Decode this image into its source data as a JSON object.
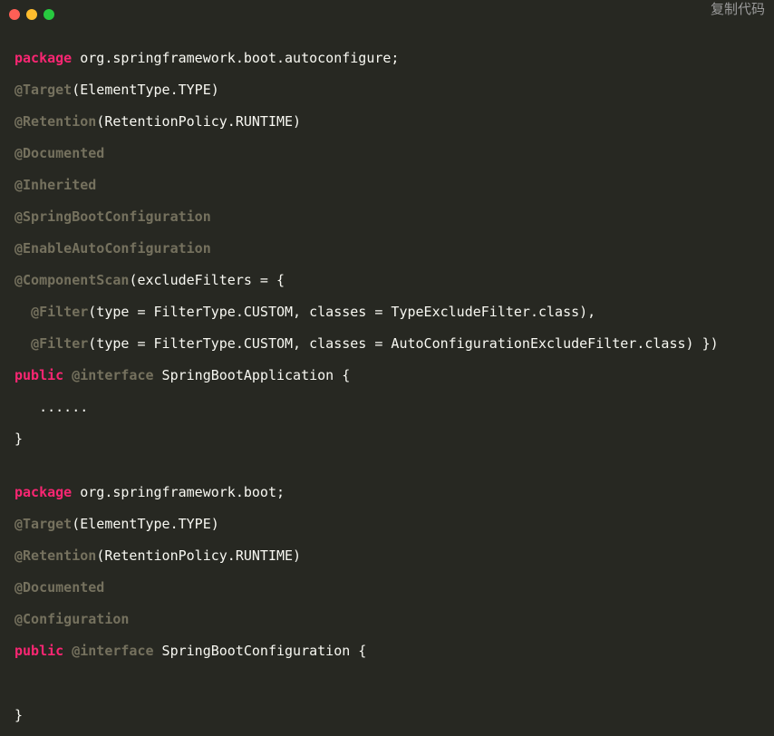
{
  "window": {
    "controls": {
      "close_color": "#ff5f56",
      "minimize_color": "#ffbd2e",
      "maximize_color": "#27c93f"
    },
    "copy_label": "复制代码"
  },
  "code": {
    "lines": [
      [
        {
          "t": "kw",
          "v": "package"
        },
        {
          "t": "pl",
          "v": " org.springframework.boot.autoconfigure;"
        }
      ],
      [
        {
          "t": "an",
          "v": "@Target"
        },
        {
          "t": "pl",
          "v": "(ElementType.TYPE)"
        }
      ],
      [
        {
          "t": "an",
          "v": "@Retention"
        },
        {
          "t": "pl",
          "v": "(RetentionPolicy.RUNTIME)"
        }
      ],
      [
        {
          "t": "an",
          "v": "@Documented"
        }
      ],
      [
        {
          "t": "an",
          "v": "@Inherited"
        }
      ],
      [
        {
          "t": "an",
          "v": "@SpringBootConfiguration"
        }
      ],
      [
        {
          "t": "an",
          "v": "@EnableAutoConfiguration"
        }
      ],
      [
        {
          "t": "an",
          "v": "@ComponentScan"
        },
        {
          "t": "pl",
          "v": "(excludeFilters = {"
        }
      ],
      [
        {
          "t": "pl",
          "v": "  "
        },
        {
          "t": "an",
          "v": "@Filter"
        },
        {
          "t": "pl",
          "v": "(type = FilterType.CUSTOM, classes = TypeExcludeFilter.class),"
        }
      ],
      [
        {
          "t": "pl",
          "v": "  "
        },
        {
          "t": "an",
          "v": "@Filter"
        },
        {
          "t": "pl",
          "v": "(type = FilterType.CUSTOM, classes = AutoConfigurationExcludeFilter.class) })"
        }
      ],
      [
        {
          "t": "kw",
          "v": "public"
        },
        {
          "t": "pl",
          "v": " "
        },
        {
          "t": "an",
          "v": "@interface"
        },
        {
          "t": "pl",
          "v": " SpringBootApplication {"
        }
      ],
      [
        {
          "t": "pl",
          "v": "   ......"
        }
      ],
      [
        {
          "t": "pl",
          "v": "}"
        }
      ],
      [],
      [
        {
          "t": "kw",
          "v": "package"
        },
        {
          "t": "pl",
          "v": " org.springframework.boot;"
        }
      ],
      [
        {
          "t": "an",
          "v": "@Target"
        },
        {
          "t": "pl",
          "v": "(ElementType.TYPE)"
        }
      ],
      [
        {
          "t": "an",
          "v": "@Retention"
        },
        {
          "t": "pl",
          "v": "(RetentionPolicy.RUNTIME)"
        }
      ],
      [
        {
          "t": "an",
          "v": "@Documented"
        }
      ],
      [
        {
          "t": "an",
          "v": "@Configuration"
        }
      ],
      [
        {
          "t": "kw",
          "v": "public"
        },
        {
          "t": "pl",
          "v": " "
        },
        {
          "t": "an",
          "v": "@interface"
        },
        {
          "t": "pl",
          "v": " SpringBootConfiguration {"
        }
      ],
      [],
      [
        {
          "t": "pl",
          "v": "}"
        }
      ]
    ]
  },
  "theme": {
    "background": "#272822",
    "keyword_color": "#f92672",
    "annotation_color": "#75715e",
    "text_color": "#f8f8f2"
  }
}
